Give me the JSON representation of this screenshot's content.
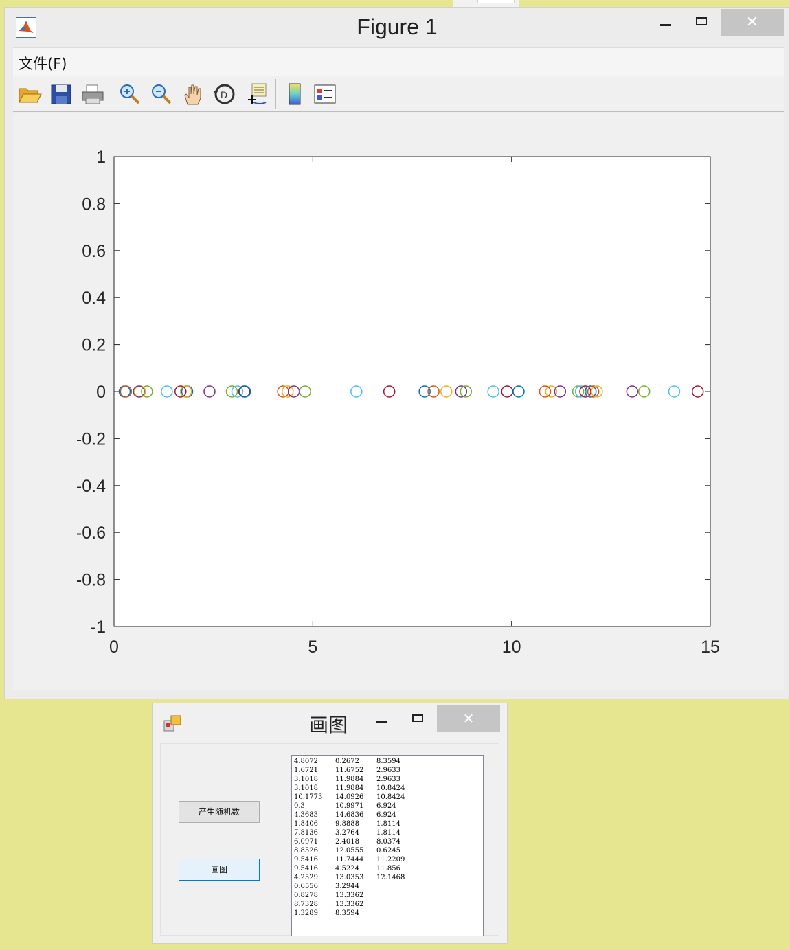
{
  "figure_window": {
    "title": "Figure 1",
    "close_glyph": "✕",
    "menu": [
      "文件(F)"
    ],
    "toolbar_icons": [
      "open-file-icon",
      "save-icon",
      "print-icon",
      "zoom-in-icon",
      "zoom-out-icon",
      "pan-hand-icon",
      "rotate-3d-icon",
      "data-cursor-icon",
      "colorbar-icon",
      "legend-icon"
    ]
  },
  "chart_data": {
    "type": "scatter",
    "marker": "open-circle",
    "xlim": [
      0,
      15
    ],
    "ylim": [
      -1,
      1
    ],
    "x_ticks": [
      "0",
      "5",
      "10",
      "15"
    ],
    "y_ticks": [
      "1",
      "0.8",
      "0.6",
      "0.4",
      "0.2",
      "0",
      "-0.2",
      "-0.4",
      "-0.6",
      "-0.8",
      "-1"
    ],
    "color_cycle": [
      "#0072BD",
      "#D95319",
      "#EDB120",
      "#7E2F8E",
      "#77AC30",
      "#4DBEEE",
      "#A2142F"
    ],
    "x": [
      0.2672,
      0.3,
      0.6556,
      0.6245,
      0.8278,
      1.3289,
      1.6721,
      1.8406,
      1.8114,
      1.8114,
      2.4018,
      2.9633,
      3.1018,
      3.2764,
      3.2944,
      4.2529,
      4.3683,
      4.5224,
      4.8072,
      6.0971,
      6.924,
      7.8136,
      8.0374,
      8.3594,
      8.7328,
      8.8526,
      9.5416,
      9.8888,
      10.1773,
      10.8424,
      10.9971,
      11.2209,
      11.6752,
      11.7444,
      11.856,
      11.9884,
      12.0555,
      12.1468,
      13.0353,
      13.3362,
      14.0926,
      14.6836
    ],
    "y": [
      0,
      0,
      0,
      0,
      0,
      0,
      0,
      0,
      0,
      0,
      0,
      0,
      0,
      0,
      0,
      0,
      0,
      0,
      0,
      0,
      0,
      0,
      0,
      0,
      0,
      0,
      0,
      0,
      0,
      0,
      0,
      0,
      0,
      0,
      0,
      0,
      0,
      0,
      0,
      0,
      0,
      0
    ]
  },
  "form_window": {
    "title": "画图",
    "close_glyph": "✕",
    "button_generate": "产生随机数",
    "button_plot": "画图",
    "list_rows": [
      [
        "4.8072",
        "0.2672",
        "8.3594"
      ],
      [
        "1.6721",
        "11.6752",
        "2.9633"
      ],
      [
        "3.1018",
        "11.9884",
        "2.9633"
      ],
      [
        "3.1018",
        "11.9884",
        "10.8424"
      ],
      [
        "10.1773",
        "14.0926",
        "10.8424"
      ],
      [
        "0.3",
        "10.9971",
        "6.924"
      ],
      [
        "4.3683",
        "14.6836",
        "6.924"
      ],
      [
        "1.8406",
        "9.8888",
        "1.8114"
      ],
      [
        "7.8136",
        "3.2764",
        "1.8114"
      ],
      [
        "6.0971",
        "2.4018",
        "8.0374"
      ],
      [
        "8.8526",
        "12.0555",
        "0.6245"
      ],
      [
        "9.5416",
        "11.7444",
        "11.2209"
      ],
      [
        "9.5416",
        "4.5224",
        "11.856"
      ],
      [
        "4.2529",
        "13.0353",
        "12.1468"
      ],
      [
        "0.6556",
        "3.2944",
        ""
      ],
      [
        "0.8278",
        "13.3362",
        ""
      ],
      [
        "8.7328",
        "13.3362",
        ""
      ],
      [
        "1.3289",
        "8.3594",
        ""
      ]
    ]
  }
}
